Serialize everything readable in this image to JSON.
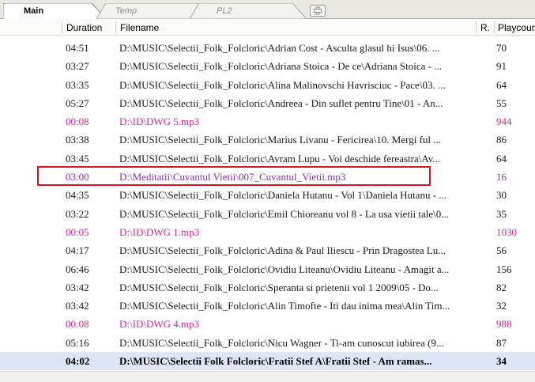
{
  "tabs": [
    {
      "label": "Main",
      "active": true
    },
    {
      "label": "Temp",
      "active": false
    },
    {
      "label": "PL2",
      "active": false
    }
  ],
  "columns": {
    "duration": "Duration",
    "filename": "Filename",
    "rating": "R.",
    "playcount": "Playcour"
  },
  "rows": [
    {
      "duration": "04:51",
      "filename": "D:\\MUSIC\\Selectii_Folk_Folcloric\\Adrian Cost - Asculta glasul hi Isus\\06. ...",
      "playcount": "70"
    },
    {
      "duration": "03:27",
      "filename": "D:\\MUSIC\\Selectii_Folk_Folcloric\\Adriana Stoica - De ce\\Adriana Stoica - ...",
      "playcount": "91"
    },
    {
      "duration": "03:35",
      "filename": "D:\\MUSIC\\Selectii_Folk_Folcloric\\Alina Malinovschi Havrisciuc - Pace\\03. ...",
      "playcount": "64"
    },
    {
      "duration": "05:27",
      "filename": "D:\\MUSIC\\Selectii_Folk_Folcloric\\Andreea - Din suflet pentru Tine\\01 - An...",
      "playcount": "55"
    },
    {
      "duration": "00:08",
      "filename": "D:\\ID\\DWG 5.mp3",
      "playcount": "944"
    },
    {
      "duration": "03:38",
      "filename": "D:\\MUSIC\\Selectii_Folk_Folcloric\\Marius Livanu - Fericirea\\10. Mergi ful ...",
      "playcount": "86"
    },
    {
      "duration": "03:45",
      "filename": "D:\\MUSIC\\Selectii_Folk_Folcloric\\Avram Lupu  - Voi deschide fereastra\\Av...",
      "playcount": "64"
    },
    {
      "duration": "03:00",
      "filename": "D:\\Meditatii\\Cuvantul Vietii\\007_Cuvantul_Vietii.mp3",
      "playcount": "16"
    },
    {
      "duration": "04:35",
      "filename": "D:\\MUSIC\\Selectii_Folk_Folcloric\\Daniela Hutanu - Vol 1\\Daniela Hutanu - ...",
      "playcount": "30"
    },
    {
      "duration": "03:22",
      "filename": "D:\\MUSIC\\Selectii_Folk_Folcloric\\Emil Chioreanu vol 8 - La usa vietii tale\\0...",
      "playcount": "35"
    },
    {
      "duration": "00:05",
      "filename": "D:\\ID\\DWG 1.mp3",
      "playcount": "1030"
    },
    {
      "duration": "04:17",
      "filename": "D:\\MUSIC\\Selectii_Folk_Folcloric\\Adina & Paul Iliescu - Prin Dragostea Lu...",
      "playcount": "56"
    },
    {
      "duration": "06:46",
      "filename": "D:\\MUSIC\\Selectii_Folk_Folcloric\\Ovidiu Liteanu\\Ovidiu Liteanu - Amagit a...",
      "playcount": "156"
    },
    {
      "duration": "03:42",
      "filename": "D:\\MUSIC\\Selectii_Folk_Folcloric\\Speranta si prietenii vol 1  2009\\05 - Do...",
      "playcount": "82"
    },
    {
      "duration": "03:42",
      "filename": "D:\\MUSIC\\Selectii_Folk_Folcloric\\Alin Timofte - Iti dau inima mea\\Alin Tim...",
      "playcount": "32"
    },
    {
      "duration": "00:08",
      "filename": "D:\\ID\\DWG 4.mp3",
      "playcount": "988"
    },
    {
      "duration": "05:16",
      "filename": "D:\\MUSIC\\Selectii_Folk_Folcloric\\Nicu Wagner - Ti-am cunoscut iubirea (9...",
      "playcount": "87"
    },
    {
      "duration": "04:02",
      "filename": "D:\\MUSIC\\Selectii  Folk  Folcloric\\Fratii Stef A\\Fratii Stef - Am ramas...",
      "playcount": "34"
    }
  ],
  "colors": {
    "jingle_text": "#d9238f",
    "highlight_text": "#8a2fa6",
    "highlight_border": "#d9141f",
    "selected_row_bg": "#dde6f6"
  }
}
